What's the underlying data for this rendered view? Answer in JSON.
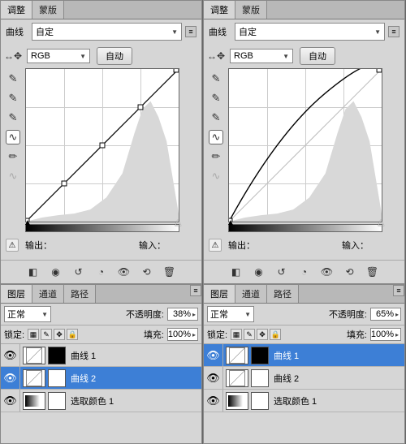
{
  "left": {
    "tabs": {
      "adjust": "调整",
      "mask": "蒙版"
    },
    "preset_label": "曲线",
    "preset_value": "自定",
    "channel": "RGB",
    "auto": "自动",
    "output_label": "输出：",
    "input_label": "输入：",
    "layers": {
      "tabs": {
        "layers": "图层",
        "channels": "通道",
        "paths": "路径"
      },
      "blend": "正常",
      "opacity_label": "不透明度:",
      "opacity_value": "38%",
      "lock_label": "锁定:",
      "fill_label": "填充:",
      "fill_value": "100%",
      "items": [
        {
          "name": "曲线 1",
          "type": "curves",
          "mask": "black",
          "selected": false
        },
        {
          "name": "曲线 2",
          "type": "curves",
          "mask": "white",
          "selected": true
        },
        {
          "name": "选取颜色 1",
          "type": "grad",
          "mask": "white",
          "selected": false
        }
      ]
    }
  },
  "right": {
    "tabs": {
      "adjust": "调整",
      "mask": "蒙版"
    },
    "preset_label": "曲线",
    "preset_value": "自定",
    "channel": "RGB",
    "auto": "自动",
    "output_label": "输出：",
    "input_label": "输入：",
    "layers": {
      "tabs": {
        "layers": "图层",
        "channels": "通道",
        "paths": "路径"
      },
      "blend": "正常",
      "opacity_label": "不透明度:",
      "opacity_value": "65%",
      "lock_label": "锁定:",
      "fill_label": "填充:",
      "fill_value": "100%",
      "items": [
        {
          "name": "曲线 1",
          "type": "curves",
          "mask": "black",
          "selected": true
        },
        {
          "name": "曲线 2",
          "type": "curves",
          "mask": "white",
          "selected": false
        },
        {
          "name": "选取颜色 1",
          "type": "grad",
          "mask": "white",
          "selected": false
        }
      ]
    }
  },
  "chart_data": [
    {
      "type": "line",
      "title": "RGB curve (left, linear)",
      "xlabel": "Input",
      "ylabel": "Output",
      "xlim": [
        0,
        255
      ],
      "ylim": [
        0,
        255
      ],
      "points": [
        [
          0,
          0
        ],
        [
          64,
          64
        ],
        [
          128,
          128
        ],
        [
          192,
          192
        ],
        [
          255,
          255
        ]
      ]
    },
    {
      "type": "line",
      "title": "RGB curve (right, lifted midtones)",
      "xlabel": "Input",
      "ylabel": "Output",
      "xlim": [
        0,
        255
      ],
      "ylim": [
        0,
        255
      ],
      "points": [
        [
          0,
          0
        ],
        [
          64,
          110
        ],
        [
          128,
          180
        ],
        [
          192,
          225
        ],
        [
          255,
          255
        ]
      ]
    }
  ]
}
